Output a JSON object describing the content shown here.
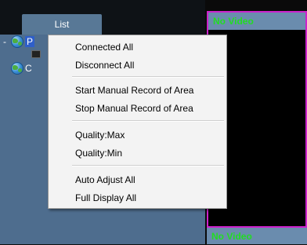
{
  "left_panel": {
    "tab_label": "List",
    "tree": [
      {
        "expander": "-",
        "label": "P",
        "selected": true
      },
      {
        "expander": "",
        "label": "C",
        "selected": false
      }
    ]
  },
  "video_panels": [
    {
      "header": "No Video"
    },
    {
      "header": "No Video"
    }
  ],
  "context_menu": {
    "groups": [
      [
        "Connected All",
        "Disconnect All"
      ],
      [
        "Start Manual Record of Area",
        "Stop Manual Record of Area"
      ],
      [
        "Quality:Max",
        "Quality:Min"
      ],
      [
        "Auto Adjust All",
        "Full Display All"
      ]
    ]
  },
  "colors": {
    "video_header_text": "#22dd22",
    "video_border": "#cc22cc",
    "tree_selection": "#2f5fc9"
  }
}
